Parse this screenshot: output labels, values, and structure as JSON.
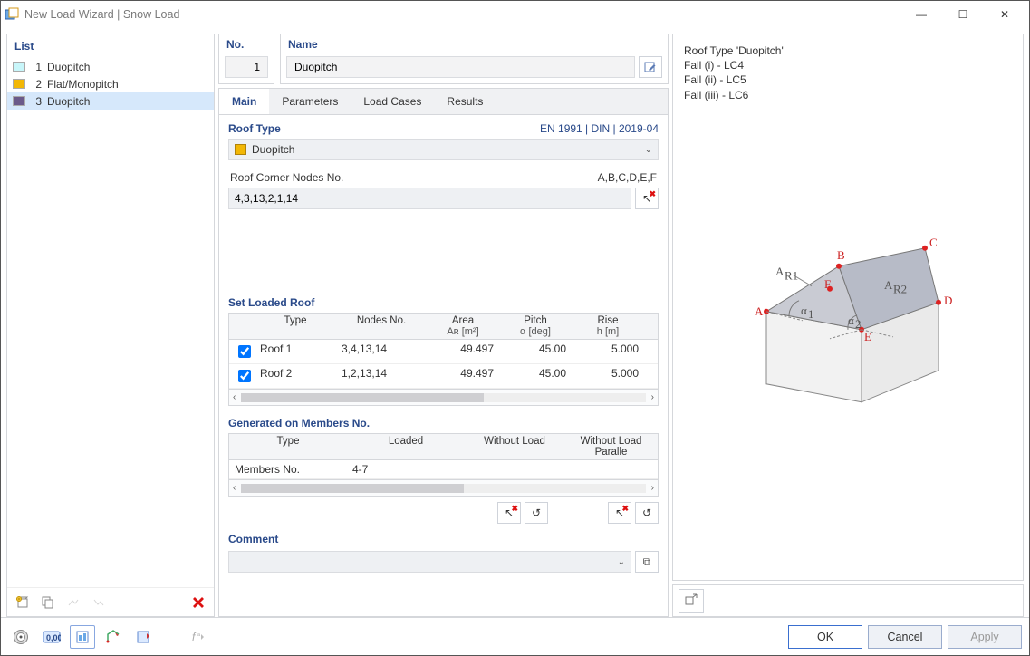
{
  "window": {
    "title": "New Load Wizard | Snow Load"
  },
  "sidebar": {
    "header": "List",
    "items": [
      {
        "num": "1",
        "label": "Duopitch",
        "color": "#c8f6fa"
      },
      {
        "num": "2",
        "label": "Flat/Monopitch",
        "color": "#f2b705"
      },
      {
        "num": "3",
        "label": "Duopitch",
        "color": "#6b5a8a"
      }
    ],
    "selected_index": 2
  },
  "form": {
    "no_label": "No.",
    "no_value": "1",
    "name_label": "Name",
    "name_value": "Duopitch"
  },
  "tabs": {
    "items": [
      "Main",
      "Parameters",
      "Load Cases",
      "Results"
    ],
    "active_index": 0
  },
  "roof_type": {
    "header": "Roof Type",
    "standard": "EN 1991 | DIN | 2019-04",
    "selected": "Duopitch",
    "corner_label": "Roof Corner Nodes No.",
    "corner_letters": "A,B,C,D,E,F",
    "corner_value": "4,3,13,2,1,14"
  },
  "loaded_roof": {
    "header": "Set Loaded Roof",
    "columns": {
      "type": "Type",
      "nodes": "Nodes No.",
      "area": "Area",
      "area_sub": "Aʀ [m²]",
      "pitch": "Pitch",
      "pitch_sub": "α [deg]",
      "rise": "Rise",
      "rise_sub": "h [m]"
    },
    "rows": [
      {
        "checked": true,
        "type": "Roof 1",
        "nodes": "3,4,13,14",
        "area": "49.497",
        "pitch": "45.00",
        "rise": "5.000"
      },
      {
        "checked": true,
        "type": "Roof 2",
        "nodes": "1,2,13,14",
        "area": "49.497",
        "pitch": "45.00",
        "rise": "5.000"
      }
    ]
  },
  "members": {
    "header": "Generated on Members No.",
    "columns": {
      "type": "Type",
      "loaded": "Loaded",
      "wo": "Without Load",
      "wop": "Without Load Paralle"
    },
    "row_label": "Members No.",
    "row_value": "4-7"
  },
  "comment": {
    "header": "Comment",
    "value": ""
  },
  "info": {
    "lines": [
      "Roof Type 'Duopitch'",
      "Fall (i) - LC4",
      "Fall (ii) - LC5",
      "Fall (iii) - LC6"
    ],
    "diagram_labels": {
      "A": "A",
      "B": "B",
      "C": "C",
      "D": "D",
      "E": "E",
      "F": "F",
      "AR1": "A",
      "AR2": "A",
      "a1": "α",
      "a2": "α"
    }
  },
  "footer": {
    "ok": "OK",
    "cancel": "Cancel",
    "apply": "Apply"
  },
  "glyphs": {
    "chev_left": "‹",
    "chev_right": "›",
    "chev_down": "⌄",
    "undo": "↺",
    "cursor": "↖",
    "min": "—",
    "max": "☐",
    "close": "✕",
    "copy": "⧉",
    "edit": "✎"
  }
}
